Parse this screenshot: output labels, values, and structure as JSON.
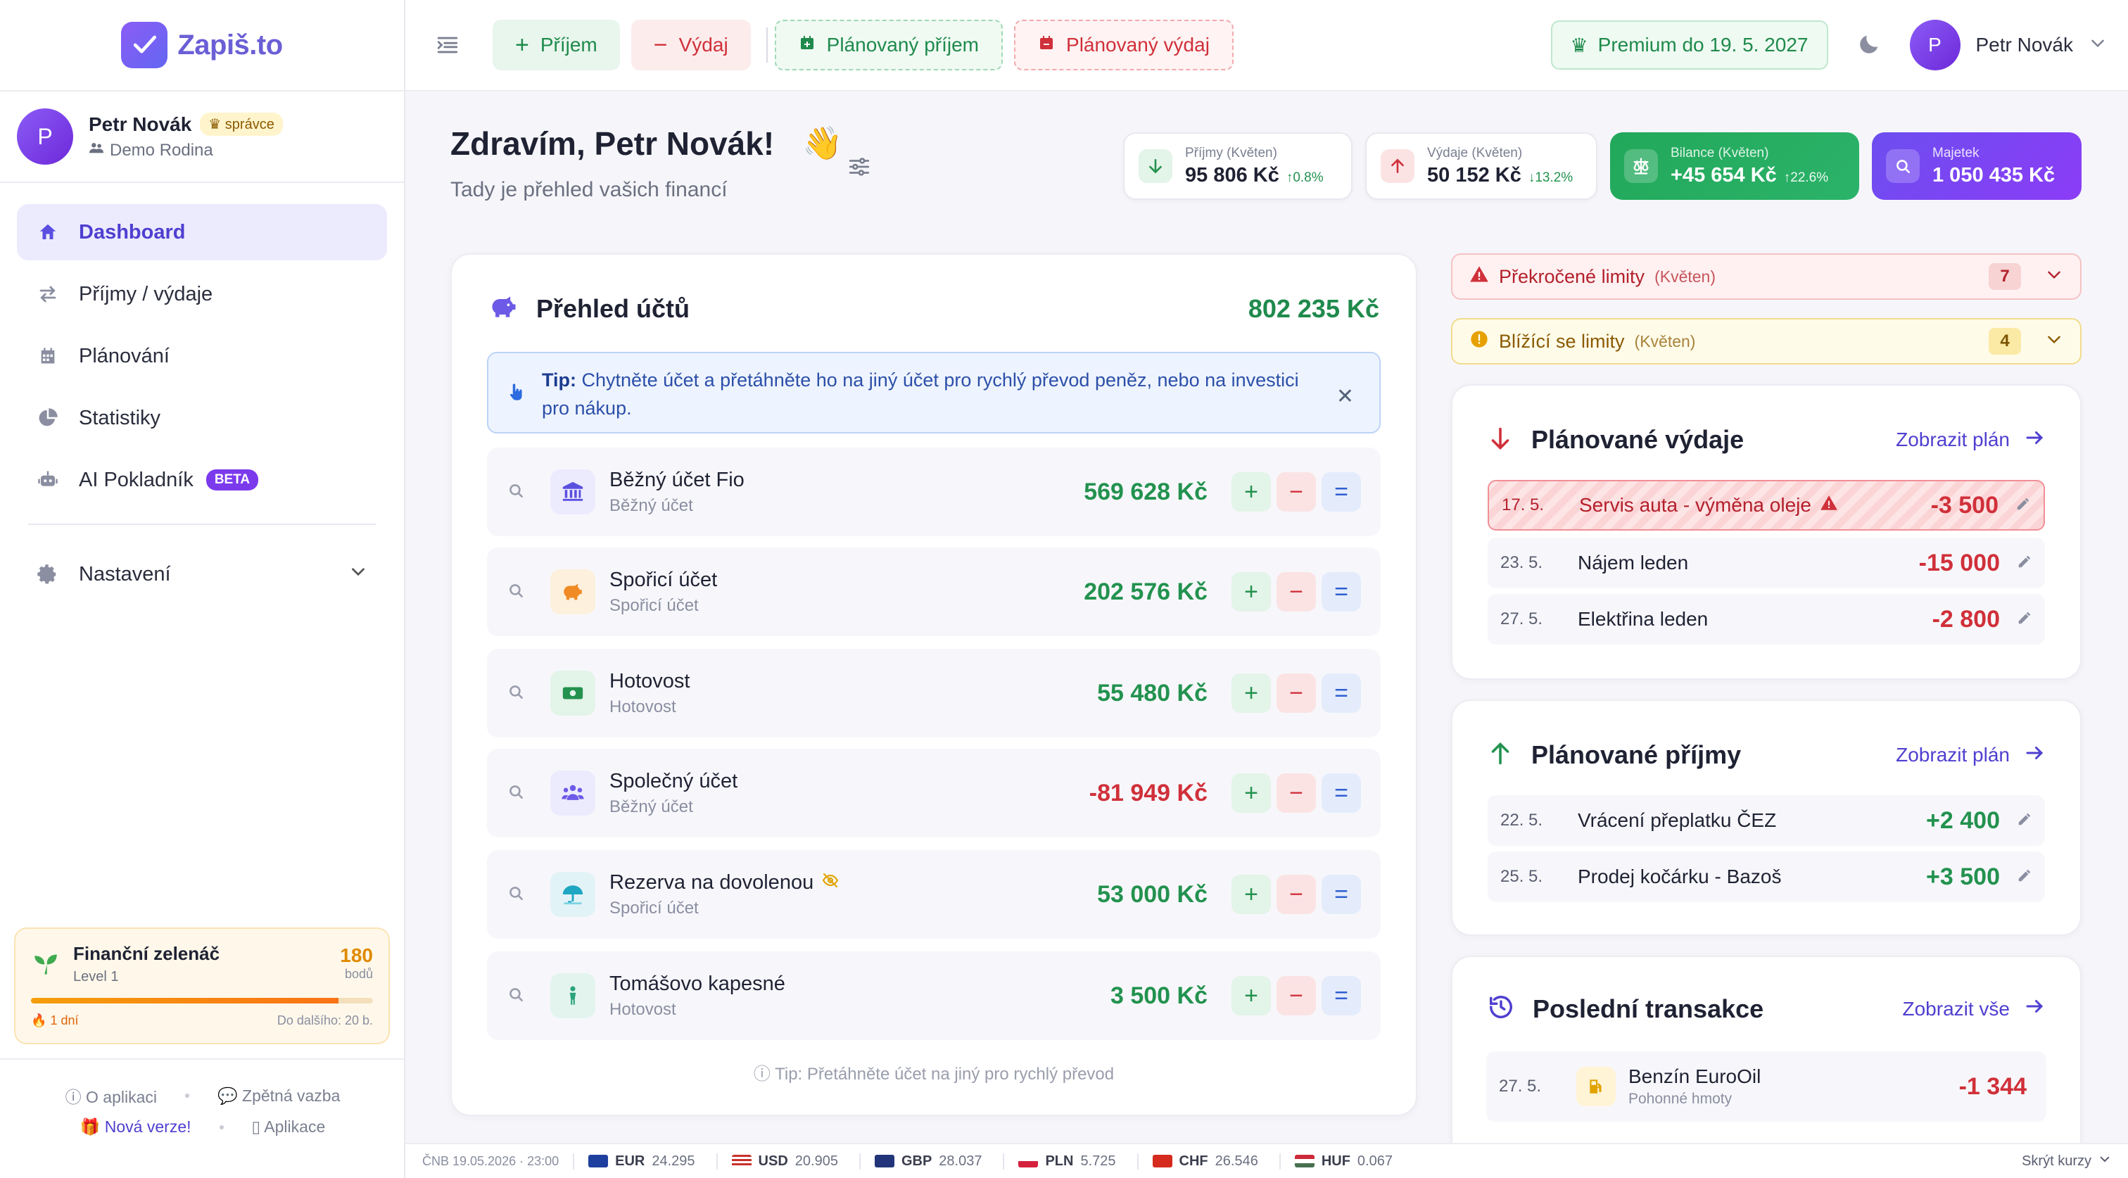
{
  "app": {
    "name": "Zapiš.to"
  },
  "sidebar": {
    "user": {
      "initial": "P",
      "name": "Petr Novák",
      "role": "správce",
      "family": "Demo Rodina"
    },
    "items": [
      {
        "label": "Dashboard",
        "icon": "home-icon"
      },
      {
        "label": "Příjmy / výdaje",
        "icon": "swap-icon"
      },
      {
        "label": "Plánování",
        "icon": "calendar-icon"
      },
      {
        "label": "Statistiky",
        "icon": "pie-chart-icon"
      },
      {
        "label": "AI Pokladník",
        "icon": "robot-icon",
        "badge": "BETA"
      }
    ],
    "settings_label": "Nastavení",
    "level": {
      "title": "Finanční zelenáč",
      "level": "Level 1",
      "points": "180",
      "points_label": "bodů",
      "streak": "1 dní",
      "next": "Do dalšího: 20 b.",
      "progress": 0.9
    },
    "footer": {
      "about": "O aplikaci",
      "feedback": "Zpětná vazba",
      "new_version": "Nová verze!",
      "apps": "Aplikace"
    }
  },
  "topbar": {
    "income": "Příjem",
    "expense": "Výdaj",
    "planned_income": "Plánovaný příjem",
    "planned_expense": "Plánovaný výdaj",
    "premium": "Premium do 19. 5. 2027",
    "user": {
      "initial": "P",
      "name": "Petr Novák"
    }
  },
  "greeting": {
    "title": "Zdravím, Petr Novák!",
    "emoji": "👋",
    "subtitle": "Tady je přehled vašich financí"
  },
  "stats": [
    {
      "label": "Příjmy (Květen)",
      "value": "95 806 Kč",
      "change": "↑0.8%"
    },
    {
      "label": "Výdaje (Květen)",
      "value": "50 152 Kč",
      "change": "↓13.2%"
    },
    {
      "label": "Bilance (Květen)",
      "value": "+45 654 Kč",
      "change": "↑22.6%"
    },
    {
      "label": "Majetek",
      "value": "1 050 435 Kč"
    }
  ],
  "accounts": {
    "title": "Přehled účtů",
    "total": "802 235 Kč",
    "tip_bold": "Tip:",
    "tip_text": "Chytněte účet a přetáhněte ho na jiný účet pro rychlý převod peněz, nebo na investici pro nákup.",
    "footer_tip": "Tip: Přetáhněte účet na jiný pro rychlý převod",
    "rows": [
      {
        "name": "Běžný účet Fio",
        "type": "Běžný účet",
        "amount": "569 628 Kč",
        "sign": "pos",
        "icon": "bank-icon",
        "color": "#ecebfe"
      },
      {
        "name": "Spořicí účet",
        "type": "Spořicí účet",
        "amount": "202 576 Kč",
        "sign": "pos",
        "icon": "piggy-bank-icon",
        "color": "#fdf0dc"
      },
      {
        "name": "Hotovost",
        "type": "Hotovost",
        "amount": "55 480 Kč",
        "sign": "pos",
        "icon": "cash-icon",
        "color": "#e3f4e8"
      },
      {
        "name": "Společný účet",
        "type": "Běžný účet",
        "amount": "-81 949 Kč",
        "sign": "neg",
        "icon": "users-icon",
        "color": "#ecebfe"
      },
      {
        "name": "Rezerva na dovolenou",
        "type": "Spořicí účet",
        "amount": "53 000 Kč",
        "sign": "pos",
        "icon": "umbrella-icon",
        "color": "#e2f3f7"
      },
      {
        "name": "Tomášovo kapesné",
        "type": "Hotovost",
        "amount": "3 500 Kč",
        "sign": "pos",
        "icon": "child-icon",
        "color": "#e3f4ee"
      }
    ]
  },
  "limits": {
    "exceeded": {
      "label": "Překročené limity",
      "month": "(Květen)",
      "count": "7"
    },
    "approaching": {
      "label": "Blížící se limity",
      "month": "(Květen)",
      "count": "4"
    }
  },
  "planned_expenses": {
    "title": "Plánované výdaje",
    "link": "Zobrazit plán",
    "rows": [
      {
        "date": "17. 5.",
        "title": "Servis auta - výměna oleje",
        "amount": "-3 500"
      },
      {
        "date": "23. 5.",
        "title": "Nájem leden",
        "amount": "-15 000"
      },
      {
        "date": "27. 5.",
        "title": "Elektřina leden",
        "amount": "-2 800"
      }
    ]
  },
  "planned_income": {
    "title": "Plánované příjmy",
    "link": "Zobrazit plán",
    "rows": [
      {
        "date": "22. 5.",
        "title": "Vrácení přeplatku ČEZ",
        "amount": "+2 400"
      },
      {
        "date": "25. 5.",
        "title": "Prodej kočárku - Bazoš",
        "amount": "+3 500"
      }
    ]
  },
  "transactions": {
    "title": "Poslední transakce",
    "link": "Zobrazit vše",
    "rows": [
      {
        "date": "27. 5.",
        "title": "Benzín EuroOil",
        "category": "Pohonné hmoty",
        "amount": "-1 344"
      }
    ]
  },
  "rates": {
    "source": "ČNB 19.05.2026 · 23:00",
    "items": [
      {
        "code": "EUR",
        "value": "24.295"
      },
      {
        "code": "USD",
        "value": "20.905"
      },
      {
        "code": "GBP",
        "value": "28.037"
      },
      {
        "code": "PLN",
        "value": "5.725"
      },
      {
        "code": "CHF",
        "value": "26.546"
      },
      {
        "code": "HUF",
        "value": "0.067"
      }
    ],
    "hide": "Skrýt kurzy"
  }
}
